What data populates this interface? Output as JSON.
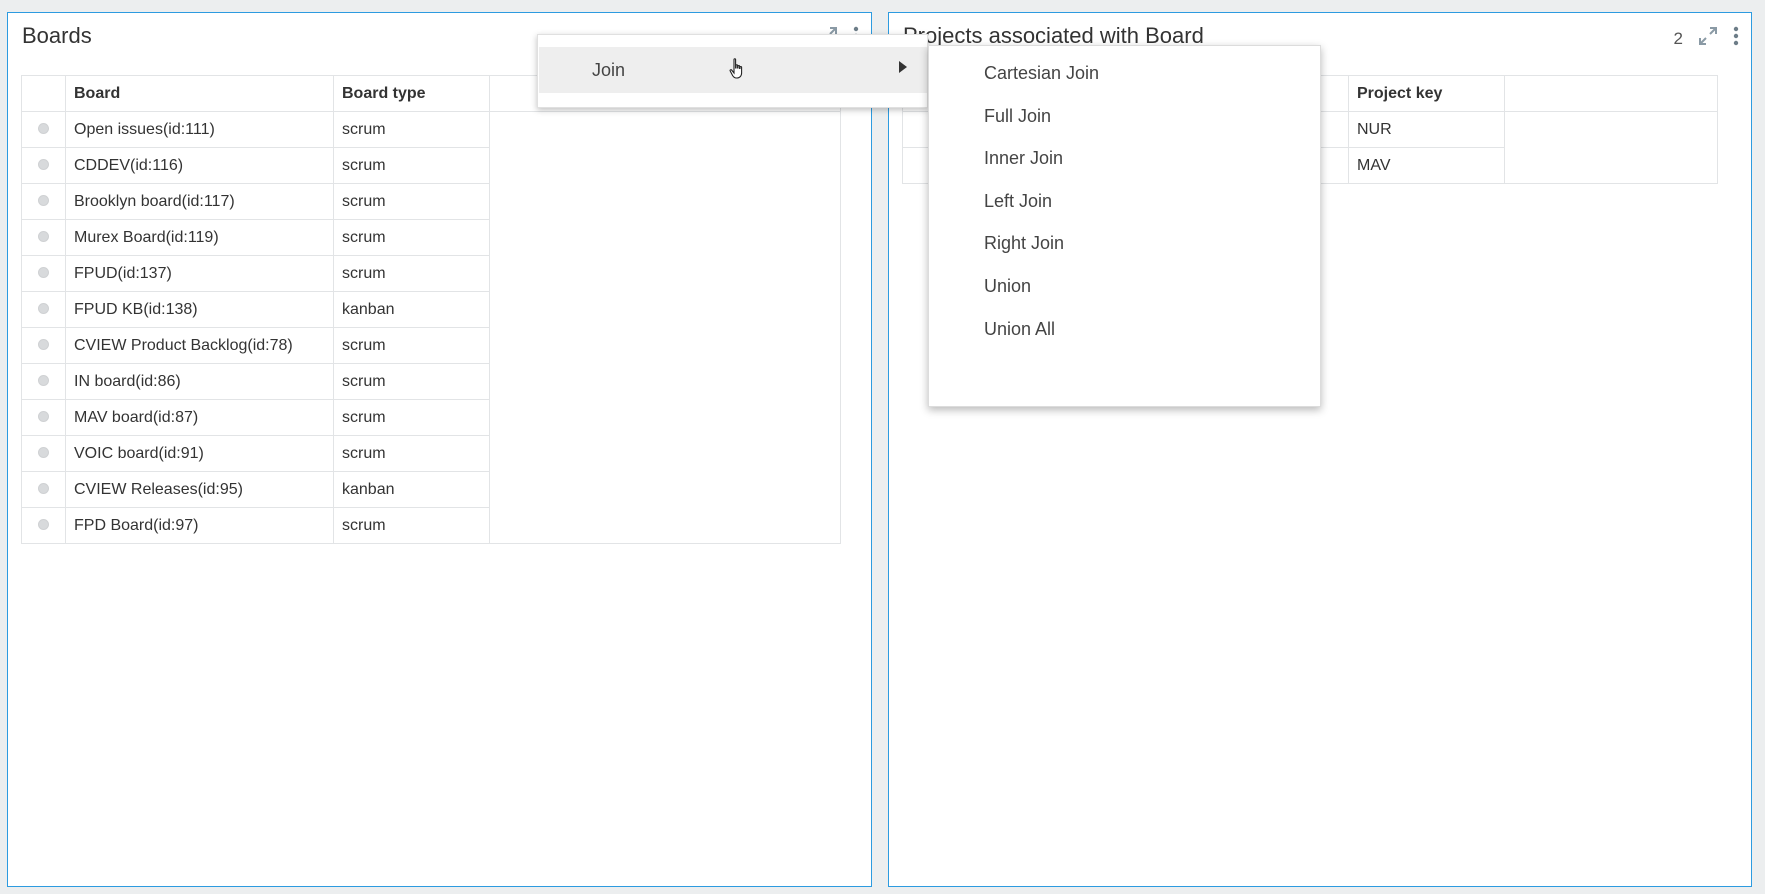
{
  "boards_panel": {
    "title": "Boards",
    "columns": [
      "Board",
      "Board type"
    ],
    "rows": [
      {
        "board": "Open issues(id:111)",
        "type": "scrum"
      },
      {
        "board": "CDDEV(id:116)",
        "type": "scrum"
      },
      {
        "board": "Brooklyn board(id:117)",
        "type": "scrum"
      },
      {
        "board": "Murex Board(id:119)",
        "type": "scrum"
      },
      {
        "board": "FPUD(id:137)",
        "type": "scrum"
      },
      {
        "board": "FPUD KB(id:138)",
        "type": "kanban"
      },
      {
        "board": "CVIEW Product Backlog(id:78)",
        "type": "scrum"
      },
      {
        "board": "IN board(id:86)",
        "type": "scrum"
      },
      {
        "board": "MAV board(id:87)",
        "type": "scrum"
      },
      {
        "board": "VOIC board(id:91)",
        "type": "scrum"
      },
      {
        "board": "CVIEW Releases(id:95)",
        "type": "kanban"
      },
      {
        "board": "FPD Board(id:97)",
        "type": "scrum"
      }
    ]
  },
  "projects_panel": {
    "title": "Projects associated with Board",
    "count": "2",
    "columns": [
      "Project key"
    ],
    "rows": [
      {
        "key": "NUR"
      },
      {
        "key": "MAV"
      }
    ]
  },
  "context_menu": {
    "item": "Join"
  },
  "join_submenu": {
    "items": [
      "Cartesian Join",
      "Full Join",
      "Inner Join",
      "Left Join",
      "Right Join",
      "Union",
      "Union All"
    ]
  },
  "icons": {
    "expand": "expand-icon",
    "more": "more-vertical-icon",
    "submenu_arrow": "caret-right-icon",
    "cursor": "hand-pointer-icon"
  },
  "colors": {
    "panel_border": "#2d9be0",
    "menu_highlight": "#eeeeee",
    "background": "#eceeef"
  }
}
